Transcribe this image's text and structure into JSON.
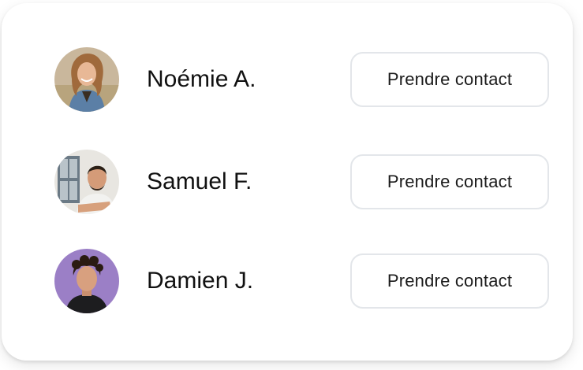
{
  "colors": {
    "card_background": "#ffffff",
    "button_border": "#e3e6ea",
    "text": "#111111"
  },
  "contacts": [
    {
      "name": "Noémie A.",
      "button_label": "Prendre contact",
      "avatar_bg": "#c9b79c"
    },
    {
      "name": "Samuel F.",
      "button_label": "Prendre contact",
      "avatar_bg": "#d9d7d2"
    },
    {
      "name": "Damien J.",
      "button_label": "Prendre contact",
      "avatar_bg": "#9b7fc6"
    }
  ]
}
